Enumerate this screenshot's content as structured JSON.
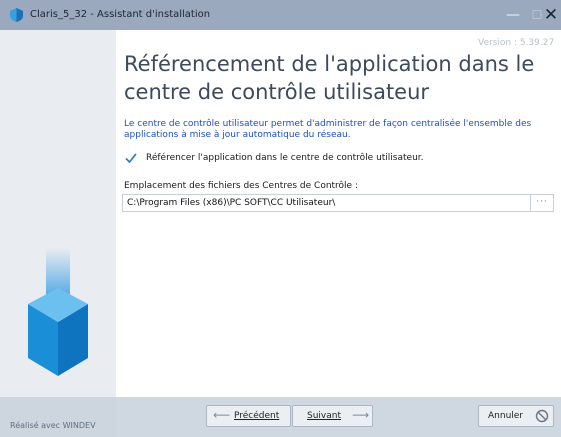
{
  "window": {
    "title": "Claris_5_32 - Assistant d'installation",
    "minimize_glyph": "—",
    "maximize_glyph": "☐",
    "close_glyph": "✕"
  },
  "version": "Version : 5.39.27",
  "heading": "Référencement de l'application dans le centre de contrôle utilisateur",
  "description": "Le centre de contrôle utilisateur permet d'administrer de façon centralisée l'ensemble des applications à mise à jour automatique du réseau.",
  "checkbox": {
    "label": "Référencer l'application dans le centre de contrôle utilisateur.",
    "checked": true
  },
  "path_field": {
    "label": "Emplacement des fichiers des Centres de Contrôle :",
    "value": "C:\\Program Files (x86)\\PC SOFT\\CC Utilisateur\\",
    "browse_label": "···"
  },
  "footer": {
    "made_with": "Réalisé avec WINDEV",
    "prev_label": "Précédent",
    "next_label": "Suivant",
    "cancel_label": "Annuler",
    "prev_arrow": "⟵",
    "next_arrow": "⟶"
  },
  "colors": {
    "titlebar": "#9aa9bd",
    "sidebar": "#e9ecf0",
    "accent_blue": "#1e4fc6",
    "arrow_blue": "#1a8fd8",
    "footer": "#cfd7e1"
  },
  "icons": {
    "app": "app-shield-icon",
    "check": "checkmark-icon",
    "sidebar": "download-arrow-icon",
    "cancel": "cancel-circle-icon"
  }
}
